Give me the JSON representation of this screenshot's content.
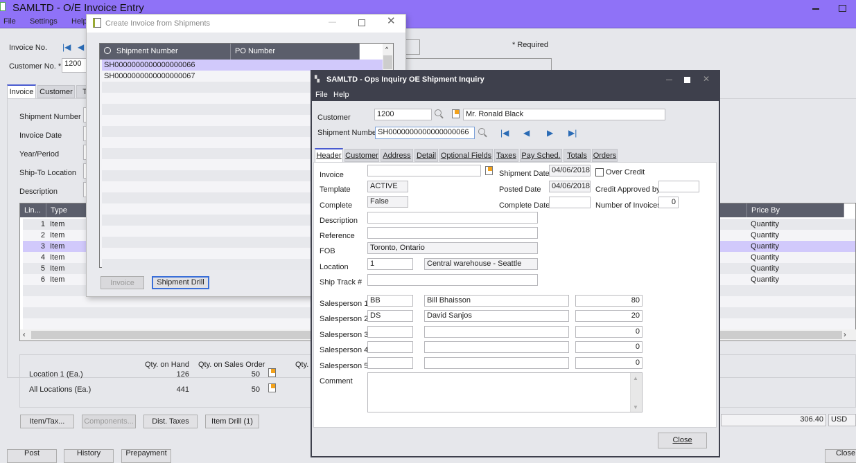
{
  "main": {
    "title": "SAMLTD - O/E Invoice Entry",
    "menu": [
      "File",
      "Settings",
      "Help"
    ],
    "invoice_no_label": "Invoice No.",
    "customer_no_label": "Customer No. *",
    "customer_no_value": "1200",
    "required_note": "* Required",
    "tabs": [
      "Invoice",
      "Customer",
      "Ta"
    ],
    "fields": [
      "Shipment Number",
      "Invoice Date",
      "Year/Period",
      "Ship-To Location",
      "Description"
    ],
    "grid": {
      "columns": [
        "Lin...",
        "Type",
        "Price By"
      ],
      "rows": [
        {
          "line": "1",
          "type": "Item",
          "price_by": "Quantity"
        },
        {
          "line": "2",
          "type": "Item",
          "price_by": "Quantity"
        },
        {
          "line": "3",
          "type": "Item",
          "price_by": "Quantity"
        },
        {
          "line": "4",
          "type": "Item",
          "price_by": "Quantity"
        },
        {
          "line": "5",
          "type": "Item",
          "price_by": "Quantity"
        },
        {
          "line": "6",
          "type": "Item",
          "price_by": "Quantity"
        }
      ],
      "selected_row": 3
    },
    "summary": {
      "col_on_hand": "Qty. on Hand",
      "col_on_so": "Qty. on Sales Order",
      "col_qty": "Qty.",
      "rows": [
        {
          "label": "Location  1 (Ea.)",
          "on_hand": "126",
          "on_so": "50"
        },
        {
          "label": "All Locations (Ea.)",
          "on_hand": "441",
          "on_so": "50"
        }
      ]
    },
    "buttons": [
      "Item/Tax...",
      "Components...",
      "Dist. Taxes",
      "Item Drill (1)"
    ],
    "total_value": "306.40",
    "currency": "USD",
    "bottom_buttons": [
      "Post",
      "History",
      "Prepayment",
      "Close"
    ]
  },
  "create_dialog": {
    "title": "Create Invoice from Shipments",
    "columns": [
      "Shipment Number",
      "PO Number"
    ],
    "rows": [
      "SH0000000000000000066",
      "SH0000000000000000067"
    ],
    "invoice_button": "Invoice",
    "shipment_drill_button": "Shipment Drill"
  },
  "inquiry": {
    "title": "SAMLTD - Ops Inquiry OE Shipment Inquiry",
    "menu": [
      "File",
      "Help"
    ],
    "customer_label": "Customer",
    "customer_value": "1200",
    "customer_name": "Mr. Ronald Black",
    "shipment_label": "Shipment Number",
    "shipment_value": "SH0000000000000000066",
    "tabs": [
      "Header",
      "Customer",
      "Address",
      "Detail",
      "Optional Fields",
      "Taxes",
      "Pay Sched.",
      "Totals",
      "Orders"
    ],
    "header": {
      "invoice_label": "Invoice",
      "invoice_value": "",
      "template_label": "Template",
      "template_value": "ACTIVE",
      "complete_label": "Complete",
      "complete_value": "False",
      "description_label": "Description",
      "description_value": "",
      "reference_label": "Reference",
      "reference_value": "",
      "fob_label": "FOB",
      "fob_value": "Toronto, Ontario",
      "location_label": "Location",
      "location_code": "1",
      "location_name": "Central warehouse - Seattle",
      "ship_track_label": "Ship Track #",
      "ship_track_value": "",
      "shipment_date_label": "Shipment Date",
      "shipment_date_value": "04/06/2018",
      "posted_date_label": "Posted Date",
      "posted_date_value": "04/06/2018",
      "complete_date_label": "Complete Date",
      "complete_date_value": "",
      "over_credit_label": "Over Credit",
      "over_credit_checked": false,
      "credit_approved_label": "Credit Approved by",
      "credit_approved_value": "",
      "num_invoices_label": "Number of Invoices",
      "num_invoices_value": "0",
      "salespersons": [
        {
          "label": "Salesperson 1",
          "code": "BB",
          "name": "Bill Bhaisson",
          "pct": "80"
        },
        {
          "label": "Salesperson 2",
          "code": "DS",
          "name": "David Sanjos",
          "pct": "20"
        },
        {
          "label": "Salesperson 3",
          "code": "",
          "name": "",
          "pct": "0"
        },
        {
          "label": "Salesperson 4",
          "code": "",
          "name": "",
          "pct": "0"
        },
        {
          "label": "Salesperson 5",
          "code": "",
          "name": "",
          "pct": "0"
        }
      ],
      "comment_label": "Comment",
      "comment_value": ""
    },
    "close_button": "Close"
  },
  "colors": {
    "main_titlebar": "#8f72f7",
    "selected_row": "#d1c9fb",
    "grid_header": "#5b5e6b",
    "inquiry_titlebar": "#3e404c"
  }
}
